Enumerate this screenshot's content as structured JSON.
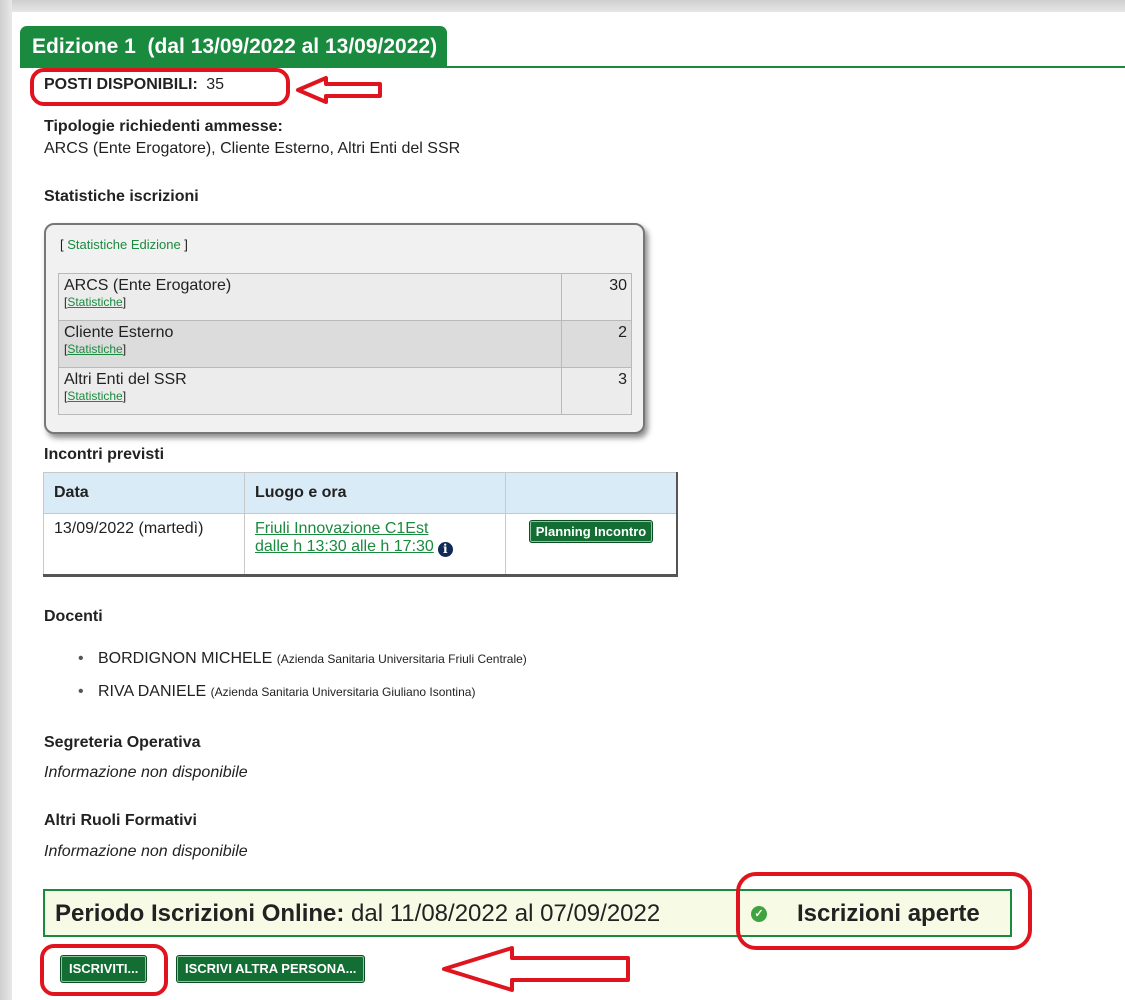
{
  "edition": {
    "title": "Edizione 1  (dal 13/09/2022 al 13/09/2022)"
  },
  "posti": {
    "label": "POSTI DISPONIBILI:",
    "value": "35"
  },
  "tipologie": {
    "heading": "Tipologie richiedenti ammesse:",
    "value": "ARCS (Ente Erogatore), Cliente Esterno, Altri Enti del SSR"
  },
  "statistiche": {
    "heading": "Statistiche iscrizioni",
    "edition_link": "Statistiche Edizione",
    "rows": [
      {
        "name": "ARCS (Ente Erogatore)",
        "link": "Statistiche",
        "count": "30"
      },
      {
        "name": "Cliente Esterno",
        "link": "Statistiche",
        "count": "2"
      },
      {
        "name": "Altri Enti del SSR",
        "link": "Statistiche",
        "count": "3"
      }
    ]
  },
  "incontri": {
    "heading": "Incontri previsti",
    "columns": [
      "Data",
      "Luogo e ora",
      ""
    ],
    "rows": [
      {
        "data": "13/09/2022 (martedì)",
        "luogo": "Friuli Innovazione C1Est",
        "ora": "dalle h 13:30 alle h 17:30",
        "button": "Planning Incontro"
      }
    ]
  },
  "docenti": {
    "heading": "Docenti",
    "items": [
      {
        "name": "BORDIGNON MICHELE",
        "org": "(Azienda Sanitaria Universitaria Friuli Centrale)"
      },
      {
        "name": "RIVA DANIELE",
        "org": "(Azienda Sanitaria Universitaria Giuliano Isontina)"
      }
    ]
  },
  "segreteria": {
    "heading": "Segreteria Operativa",
    "value": "Informazione non disponibile"
  },
  "altri_ruoli": {
    "heading": "Altri Ruoli Formativi",
    "value": "Informazione non disponibile"
  },
  "periodo": {
    "label": "Periodo Iscrizioni Online:",
    "value": "dal 11/08/2022 al 07/09/2022",
    "status": "Iscrizioni aperte"
  },
  "buttons": {
    "iscriviti": "ISCRIVITI...",
    "iscrivi_altra": "ISCRIVI ALTRA PERSONA..."
  },
  "colors": {
    "brand_green": "#1a8a3f",
    "button_green": "#136e33",
    "highlight_red": "#e0141e"
  }
}
